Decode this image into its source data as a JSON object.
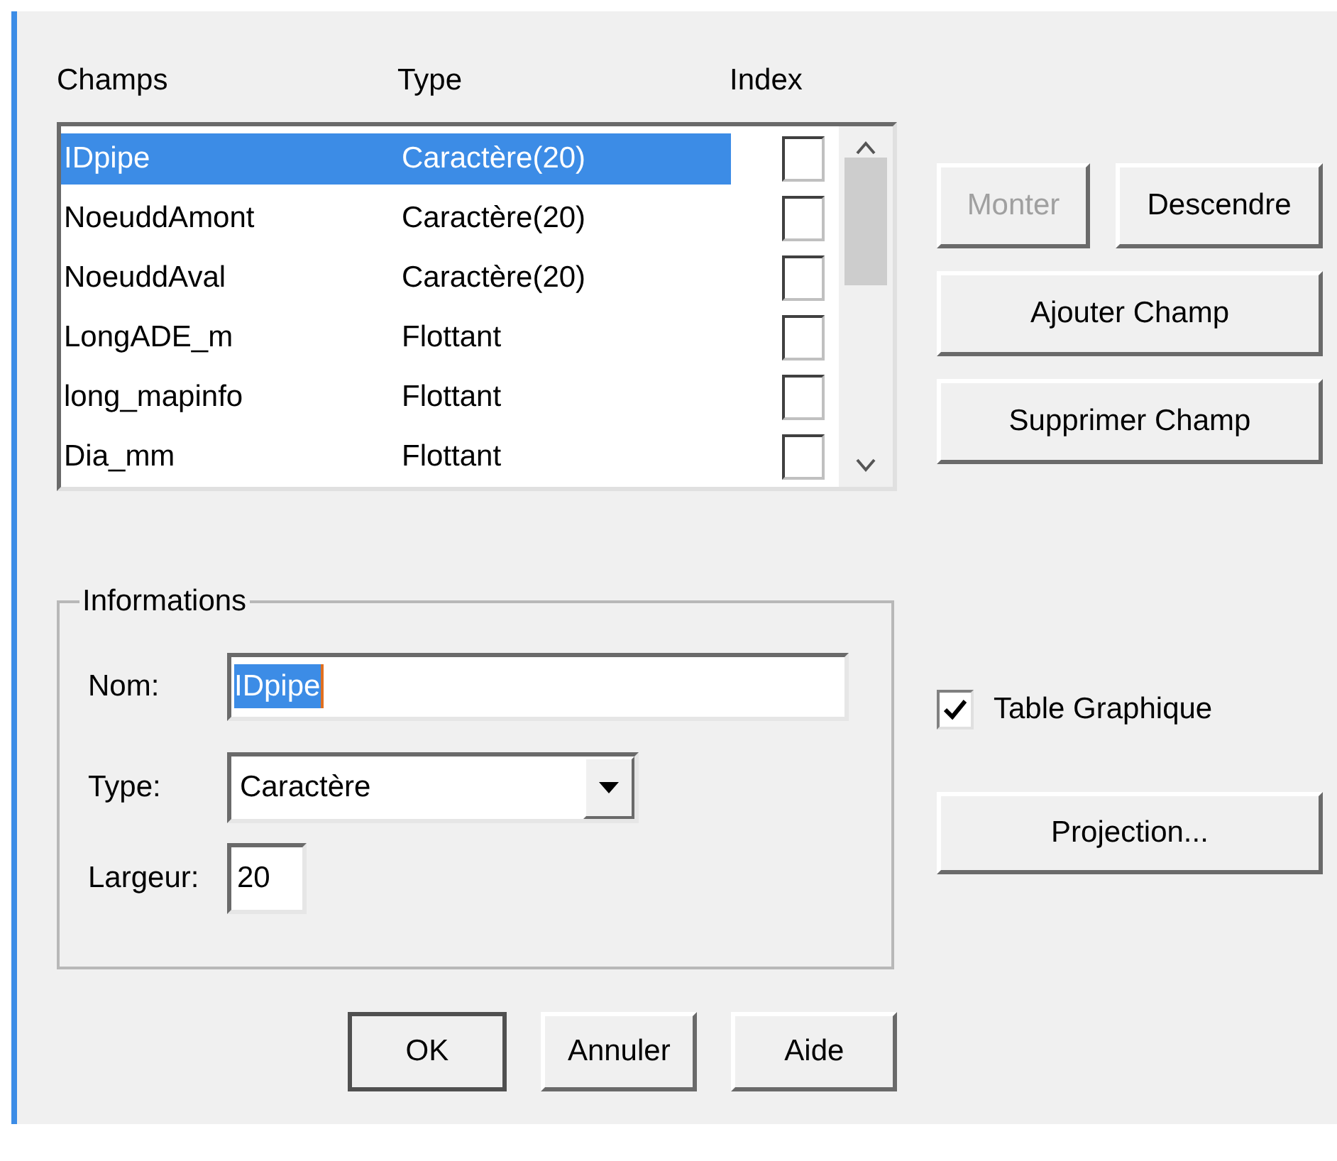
{
  "fields_list": {
    "columns": [
      "Champs",
      "Type",
      "Index"
    ],
    "rows": [
      {
        "name": "IDpipe",
        "type": "Caractère(20)",
        "indexed": false,
        "selected": true
      },
      {
        "name": "NoeuddAmont",
        "type": "Caractère(20)",
        "indexed": false,
        "selected": false
      },
      {
        "name": "NoeuddAval",
        "type": "Caractère(20)",
        "indexed": false,
        "selected": false
      },
      {
        "name": "LongADE_m",
        "type": "Flottant",
        "indexed": false,
        "selected": false
      },
      {
        "name": "long_mapinfo",
        "type": "Flottant",
        "indexed": false,
        "selected": false
      },
      {
        "name": "Dia_mm",
        "type": "Flottant",
        "indexed": false,
        "selected": false
      }
    ]
  },
  "side_buttons": [
    {
      "label": "Monter",
      "disabled": true
    },
    {
      "label": "Descendre",
      "disabled": false
    },
    {
      "label": "Ajouter Champ",
      "disabled": false
    },
    {
      "label": "Supprimer Champ",
      "disabled": false
    }
  ],
  "informations": {
    "title": "Informations",
    "nom": {
      "label": "Nom:",
      "value": "IDpipe"
    },
    "type": {
      "label": "Type:",
      "value": "Caractère"
    },
    "largeur": {
      "label": "Largeur:",
      "value": "20"
    }
  },
  "table_graphique": {
    "label": "Table Graphique",
    "checked": true
  },
  "projection_button": {
    "label": "Projection..."
  },
  "dialog_buttons": [
    {
      "label": "OK",
      "default": true
    },
    {
      "label": "Annuler",
      "default": false
    },
    {
      "label": "Aide",
      "default": false
    }
  ]
}
